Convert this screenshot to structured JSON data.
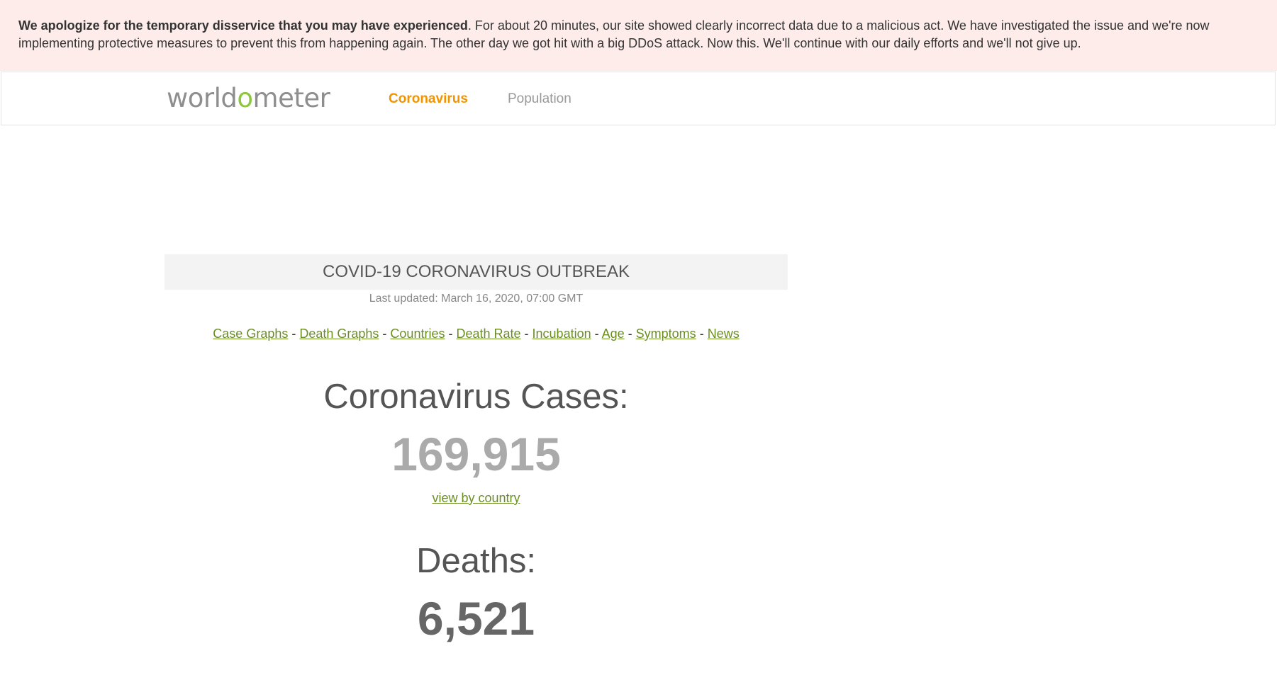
{
  "notice": {
    "bold_text": "We apologize for the temporary disservice that you may have experienced",
    "body_text": ". For about 20 minutes, our site showed clearly incorrect data due to a malicious act. We have investigated the issue and we're now implementing protective measures to prevent this from happening again. The other day we got hit with a big DDoS attack. Now this. We'll continue with our daily efforts and we'll not give up."
  },
  "nav": {
    "logo_prefix": "world",
    "logo_o": "o",
    "logo_suffix": "meter",
    "items": [
      {
        "label": "Coronavirus",
        "active": true
      },
      {
        "label": "Population",
        "active": false
      }
    ]
  },
  "main": {
    "title": "COVID-19 CORONAVIRUS OUTBREAK",
    "last_updated": "Last updated: March 16, 2020, 07:00 GMT",
    "links": [
      {
        "label": "Case Graphs"
      },
      {
        "label": "Death Graphs"
      },
      {
        "label": "Countries"
      },
      {
        "label": "Death Rate"
      },
      {
        "label": "Incubation"
      },
      {
        "label": "Age"
      },
      {
        "label": "Symptoms"
      },
      {
        "label": "News"
      }
    ],
    "separator": " - ",
    "cases": {
      "label": "Coronavirus Cases:",
      "value": "169,915",
      "link": "view by country"
    },
    "deaths": {
      "label": "Deaths:",
      "value": "6,521"
    }
  },
  "colors": {
    "notice_bg": "#fdecea",
    "nav_active": "#f29400",
    "link_green": "#6b8e23",
    "logo_green": "#8dc63f"
  }
}
